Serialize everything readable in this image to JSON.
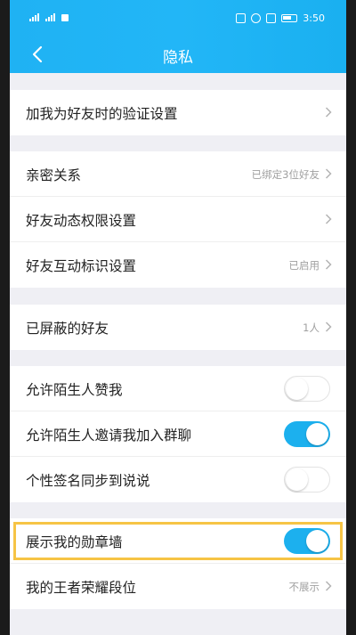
{
  "status_bar": {
    "time": "3:50"
  },
  "header": {
    "title": "隐私"
  },
  "groups": [
    {
      "items": [
        {
          "label": "加我为好友时的验证设置",
          "value": ""
        }
      ]
    },
    {
      "items": [
        {
          "label": "亲密关系",
          "value": "已绑定3位好友"
        },
        {
          "label": "好友动态权限设置",
          "value": ""
        },
        {
          "label": "好友互动标识设置",
          "value": "已启用"
        }
      ]
    },
    {
      "items": [
        {
          "label": "已屏蔽的好友",
          "value": "1人"
        }
      ]
    },
    {
      "items": [
        {
          "label": "允许陌生人赞我",
          "toggle": "off"
        },
        {
          "label": "允许陌生人邀请我加入群聊",
          "toggle": "on"
        },
        {
          "label": "个性签名同步到说说",
          "toggle": "off"
        }
      ]
    },
    {
      "items": [
        {
          "label": "展示我的勋章墙",
          "toggle": "on"
        },
        {
          "label": "我的王者荣耀段位",
          "value": "不展示"
        }
      ]
    }
  ],
  "colors": {
    "accent": "#1cb0ee",
    "highlight": "#f6c445"
  }
}
